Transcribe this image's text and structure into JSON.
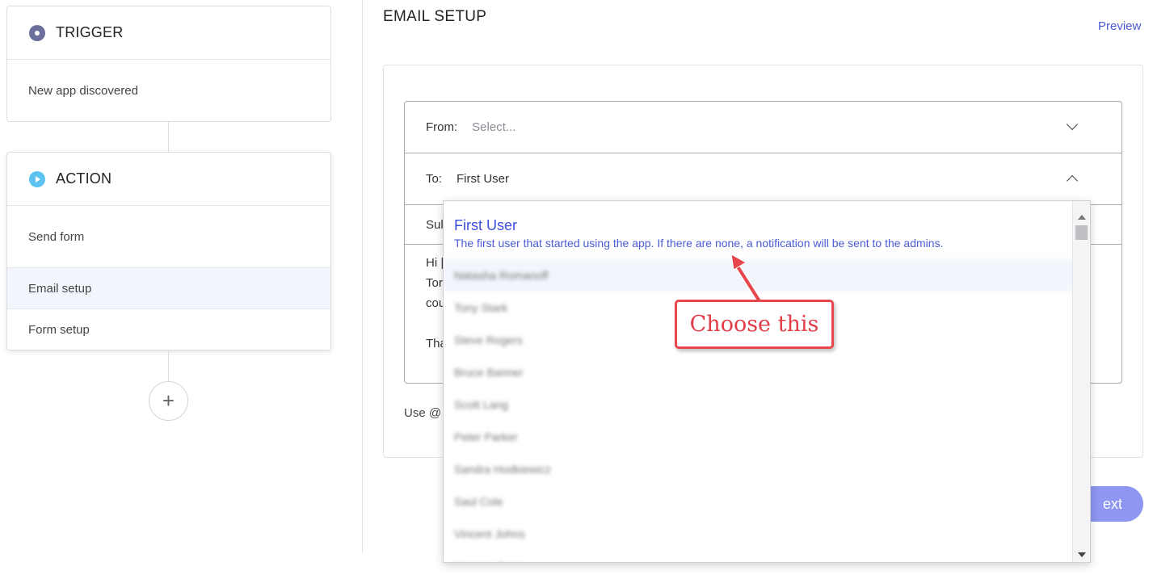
{
  "workflow": {
    "trigger": {
      "title": "TRIGGER",
      "icon": "trigger-dot-icon",
      "item": "New app discovered"
    },
    "action": {
      "title": "ACTION",
      "icon": "play-icon",
      "items": [
        "Send form",
        "Email setup",
        "Form setup"
      ],
      "selected": "Email setup"
    },
    "add_icon": "plus-icon"
  },
  "email_setup": {
    "title": "EMAIL SETUP",
    "preview_label": "Preview",
    "from": {
      "label": "From:",
      "placeholder": "Select..."
    },
    "to": {
      "label": "To:",
      "value": "First User"
    },
    "subject_label_partial": "Sul",
    "body_lines": [
      "Hi |",
      "Tor",
      "cou",
      "Tha"
    ],
    "hint_partial": "Use @",
    "next_label_partial": "ext"
  },
  "dropdown": {
    "first_option": {
      "title": "First User",
      "description": "The first user that started using the app. If there are none, a notification will be sent to the admins."
    },
    "options": [
      "Natasha Romanoff",
      "Tony Stark",
      "Steve Rogers",
      "Bruce Banner",
      "Scott Lang",
      "Peter Parker",
      "Sandra Hodkiewicz",
      "Saul Cole",
      "Vincent Johns",
      "Harmon Dent"
    ],
    "highlighted_index": 0
  },
  "annotation": {
    "text": "Choose this",
    "color": "#e8454d"
  },
  "colors": {
    "accent": "#4a5bd4",
    "next_button": "#8e96f2",
    "trigger_icon": "#6b6f9c",
    "action_icon": "#5bc2f2"
  }
}
